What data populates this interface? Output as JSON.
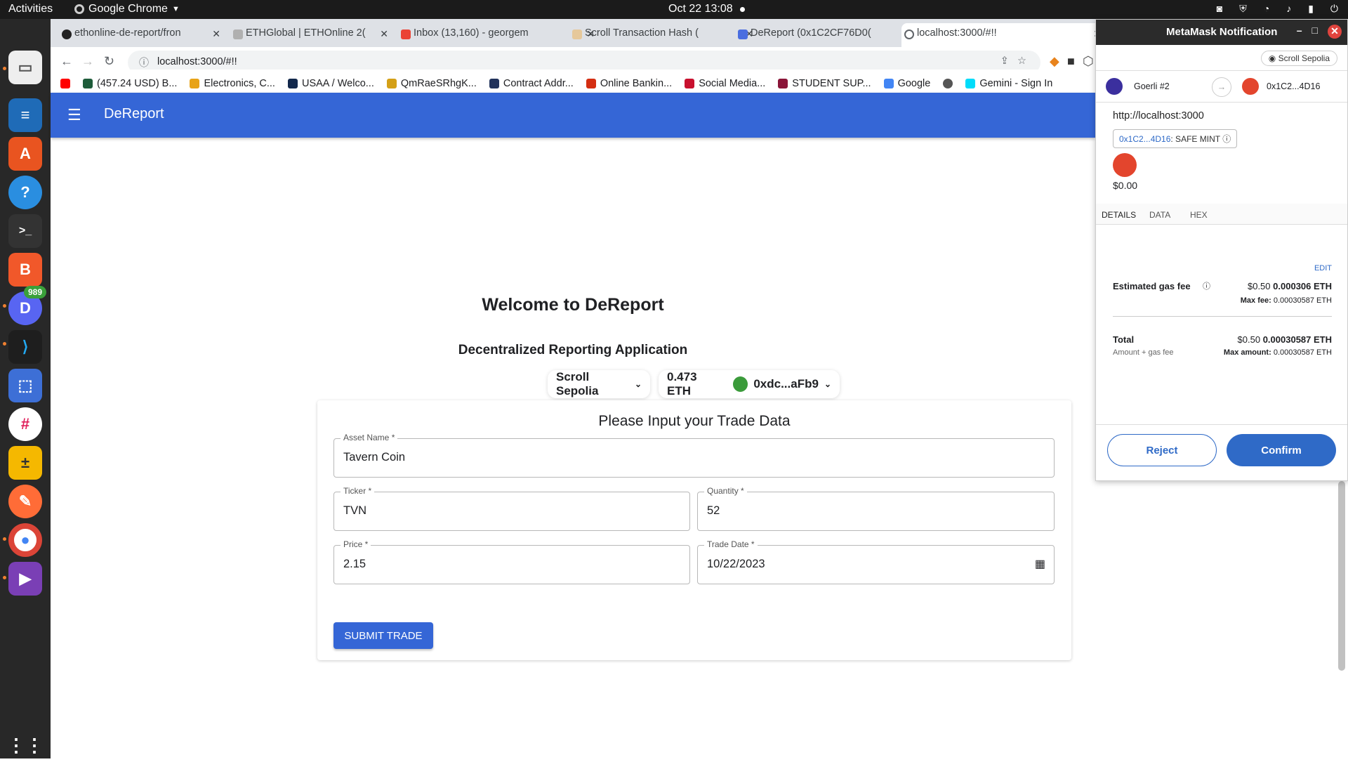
{
  "os": {
    "activities": "Activities",
    "app_name": "Google Chrome",
    "clock": "Oct 22  13:08",
    "dock_badge": "989"
  },
  "browser": {
    "tabs": [
      {
        "label": "ethonline-de-report/fron"
      },
      {
        "label": "ETHGlobal | ETHOnline 2("
      },
      {
        "label": "Inbox (13,160) - georgem"
      },
      {
        "label": "Scroll Transaction Hash ("
      },
      {
        "label": "DeReport (0x1C2CF76D0("
      },
      {
        "label": "localhost:3000/#!!"
      }
    ],
    "url": "localhost:3000/#!!",
    "bookmarks": [
      {
        "label": "(457.24 USD) B...",
        "color": "#1e5c3a"
      },
      {
        "label": "Electronics, C...",
        "color": "#e8a317"
      },
      {
        "label": "USAA / Welco...",
        "color": "#12284c"
      },
      {
        "label": "QmRaeSRhgK...",
        "color": "#d4a017"
      },
      {
        "label": "Contract Addr...",
        "color": "#21325b"
      },
      {
        "label": "Online Bankin...",
        "color": "#d42e12"
      },
      {
        "label": "Social Media...",
        "color": "#c8102e"
      },
      {
        "label": "STUDENT SUP...",
        "color": "#8a1538"
      },
      {
        "label": "Google",
        "color": "#4285f4"
      },
      {
        "label": "",
        "color": "#555555"
      },
      {
        "label": "Gemini - Sign In",
        "color": "#00dcfa"
      }
    ]
  },
  "app": {
    "title": "DeReport",
    "welcome": "Welcome to DeReport",
    "subtitle": "Decentralized Reporting Application",
    "network": "Scroll Sepolia",
    "balance": "0.473 ETH",
    "account": "0xdc...aFb9",
    "form": {
      "heading": "Please Input your Trade Data",
      "asset_label": "Asset Name *",
      "asset_value": "Tavern Coin",
      "ticker_label": "Ticker *",
      "ticker_value": "TVN",
      "quantity_label": "Quantity *",
      "quantity_value": "52",
      "price_label": "Price *",
      "price_value": "2.15",
      "date_label": "Trade Date *",
      "date_value": "10/22/2023",
      "submit": "SUBMIT TRADE"
    }
  },
  "metamask": {
    "title": "MetaMask Notification",
    "network": "Scroll Sepolia",
    "from_account": "Goerli #2",
    "to_account": "0x1C2...4D16",
    "origin": "http://localhost:3000",
    "method_address": "0x1C2...4D16",
    "method_name": ": SAFE MINT",
    "amount": "$0.00",
    "tabs": [
      "DETAILS",
      "DATA",
      "HEX"
    ],
    "edit": "EDIT",
    "gas_label": "Estimated gas fee",
    "gas_usd": "$0.50",
    "gas_eth": "0.000306 ETH",
    "max_fee_label": "Max fee:",
    "max_fee_value": "0.00030587 ETH",
    "total_label": "Total",
    "total_sub": "Amount + gas fee",
    "total_usd": "$0.50",
    "total_eth": "0.00030587 ETH",
    "max_amount_label": "Max amount:",
    "max_amount_value": "0.00030587 ETH",
    "reject": "Reject",
    "confirm": "Confirm"
  },
  "colors": {
    "appbar": "#3566d6",
    "metamask_primary": "#2f6ac7"
  }
}
